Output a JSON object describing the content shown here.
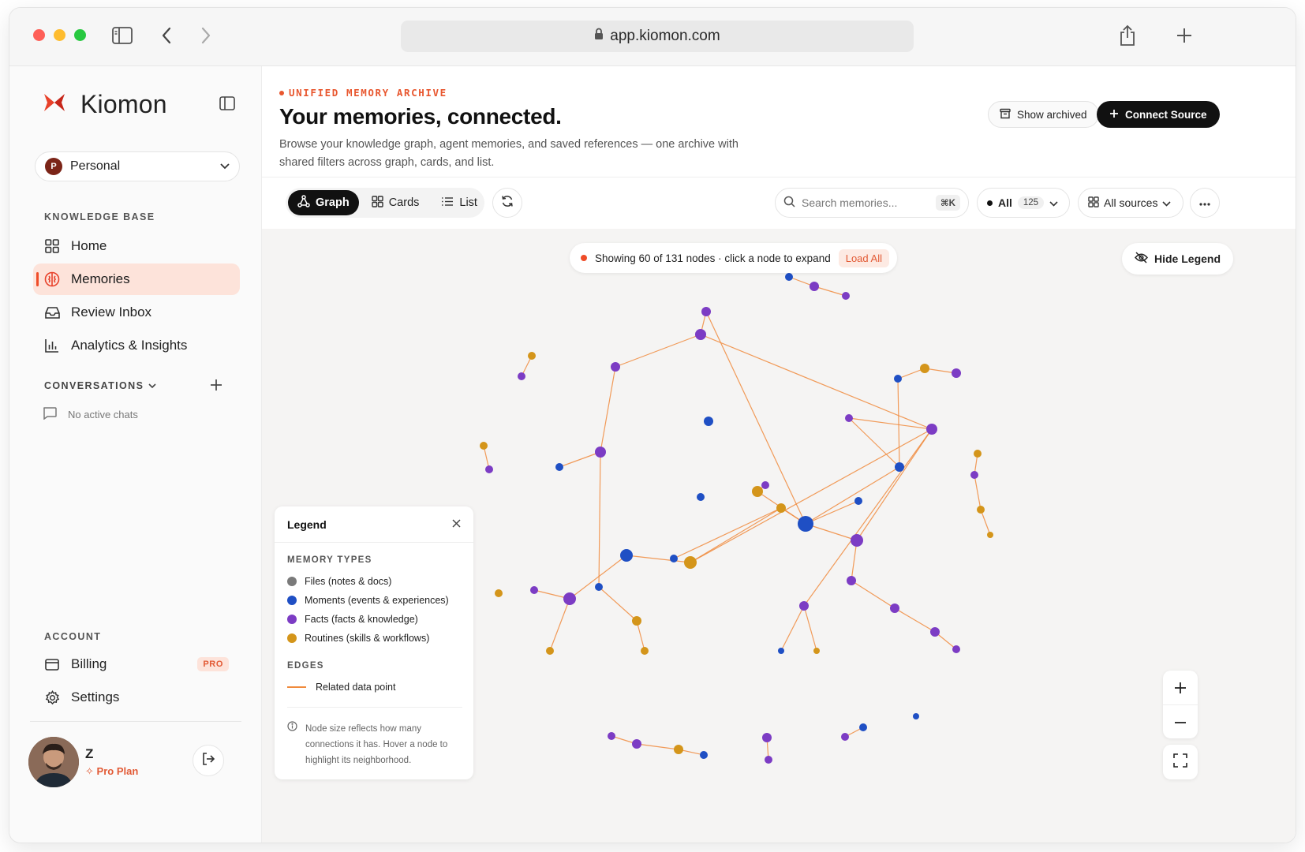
{
  "browser": {
    "url": "app.kiomon.com"
  },
  "sidebar": {
    "brand": "Kiomon",
    "workspace": {
      "initial": "P",
      "name": "Personal"
    },
    "knowledge_title": "KNOWLEDGE BASE",
    "nav": [
      {
        "label": "Home",
        "icon": "grid-icon"
      },
      {
        "label": "Memories",
        "icon": "brain-icon",
        "active": true
      },
      {
        "label": "Review Inbox",
        "icon": "inbox-icon"
      },
      {
        "label": "Analytics & Insights",
        "icon": "bar-chart-icon"
      }
    ],
    "conversations_title": "CONVERSATIONS",
    "no_chats": "No active chats",
    "account_title": "ACCOUNT",
    "account": [
      {
        "label": "Billing",
        "badge": "PRO"
      },
      {
        "label": "Settings"
      }
    ],
    "user": {
      "name": "Z",
      "plan": "Pro Plan"
    }
  },
  "header": {
    "eyebrow": "UNIFIED MEMORY ARCHIVE",
    "title": "Your memories, connected.",
    "description": "Browse your knowledge graph, agent memories, and saved references — one archive with shared filters across graph, cards, and list.",
    "show_archived": "Show archived",
    "connect_source": "Connect Source"
  },
  "toolbar": {
    "views": [
      "Graph",
      "Cards",
      "List"
    ],
    "active_view": "Graph",
    "search_placeholder": "Search memories...",
    "search_shortcut": "⌘K",
    "filter_all": "All",
    "filter_count": "125",
    "sources": "All sources"
  },
  "graph": {
    "notice": "Showing 60 of 131 nodes · click a node to expand",
    "load_all": "Load All",
    "hide_legend": "Hide Legend"
  },
  "legend": {
    "title": "Legend",
    "types_title": "MEMORY TYPES",
    "types": [
      {
        "label": "Files (notes & docs)",
        "color": "#7a7a7a"
      },
      {
        "label": "Moments (events & experiences)",
        "color": "#1f4fc4"
      },
      {
        "label": "Facts (facts & knowledge)",
        "color": "#7c3cc4"
      },
      {
        "label": "Routines (skills & workflows)",
        "color": "#d4951a"
      }
    ],
    "edges_title": "EDGES",
    "edge_label": "Related data point",
    "edge_color": "#f08a3c",
    "note": "Node size reflects how many connections it has. Hover a node to highlight its neighborhood."
  },
  "colors": {
    "accent": "#ef4c28",
    "moment": "#1f4fc4",
    "fact": "#7c3cc4",
    "routine": "#d4951a",
    "edge": "#f08a3c"
  }
}
